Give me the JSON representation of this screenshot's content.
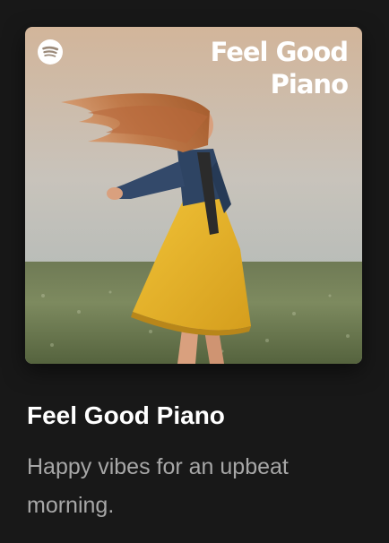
{
  "playlist": {
    "cover_title": "Feel Good Piano",
    "title": "Feel Good Piano",
    "description": "Happy vibes for an upbeat morning."
  },
  "icons": {
    "brand": "spotify-logo-icon"
  },
  "colors": {
    "background": "#181818",
    "title": "#ffffff",
    "description": "#a7a7a7",
    "dress": "#e8b52a",
    "jacket": "#2e4463"
  }
}
